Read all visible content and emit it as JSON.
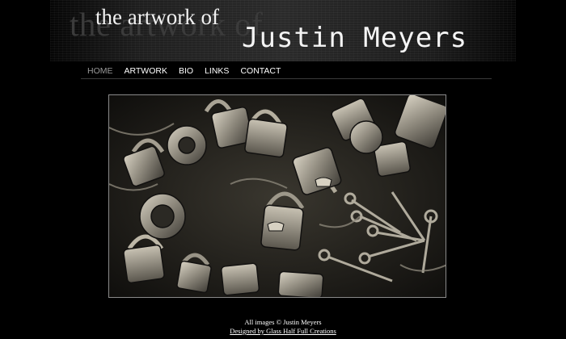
{
  "header": {
    "ghost_text": "the artwork of",
    "tagline": "the artwork of",
    "artist_name": "Justin Meyers"
  },
  "nav": {
    "items": [
      {
        "label": "HOME",
        "current": true
      },
      {
        "label": "ARTWORK",
        "current": false
      },
      {
        "label": "BIO",
        "current": false
      },
      {
        "label": "LINKS",
        "current": false
      },
      {
        "label": "CONTACT",
        "current": false
      }
    ]
  },
  "footer": {
    "copyright": "All images © Justin Meyers",
    "credit_link": "Designed by Glass Half Full Creations"
  }
}
